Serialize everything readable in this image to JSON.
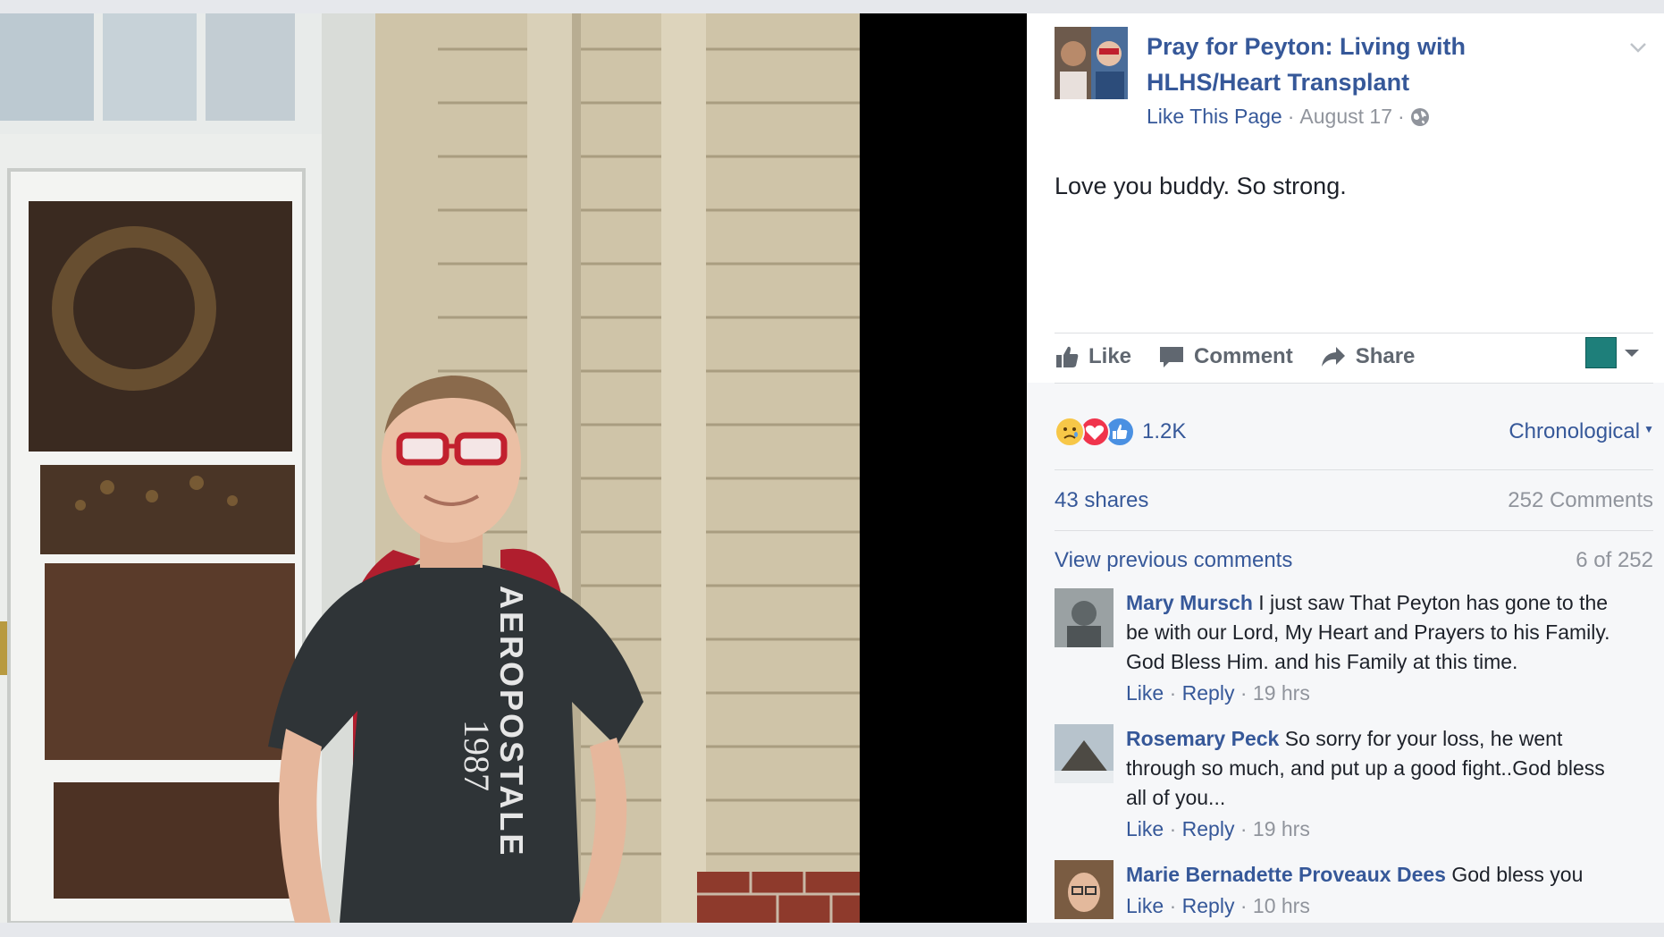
{
  "post": {
    "page_name": "Pray for Peyton: Living with HLHS/Heart Transplant",
    "like_page_label": "Like This Page",
    "separator": "·",
    "date": "August 17",
    "audience_icon": "globe-icon",
    "text": "Love you buddy. So strong."
  },
  "actions": {
    "like_label": "Like",
    "comment_label": "Comment",
    "share_label": "Share"
  },
  "feedback": {
    "reaction_icons": [
      "sad-reaction-icon",
      "love-reaction-icon",
      "like-reaction-icon"
    ],
    "reaction_count": "1.2K",
    "sort_label": "Chronological",
    "shares_label": "43 shares",
    "comments_label": "252 Comments",
    "view_previous_label": "View previous comments",
    "pager_label": "6 of 252"
  },
  "comments": [
    {
      "author": "Mary Mursch",
      "text": "I just saw That Peyton has gone to the be with our Lord, My Heart and Prayers to his Family. God Bless Him. and his Family at this time.",
      "like": "Like",
      "reply": "Reply",
      "time": "19 hrs"
    },
    {
      "author": "Rosemary Peck",
      "text": "So sorry for your loss, he went through so much, and put up a good fight..God bless all of you...",
      "like": "Like",
      "reply": "Reply",
      "time": "19 hrs"
    },
    {
      "author": "Marie Bernadette Proveaux Dees",
      "text": "God bless you",
      "like": "Like",
      "reply": "Reply",
      "time": "10 hrs"
    }
  ],
  "colors": {
    "link_blue": "#365899",
    "muted_grey": "#90949c",
    "panel_background": "#ffffff",
    "comments_background": "#f6f7f9",
    "photo_letterbox": "#000000"
  }
}
